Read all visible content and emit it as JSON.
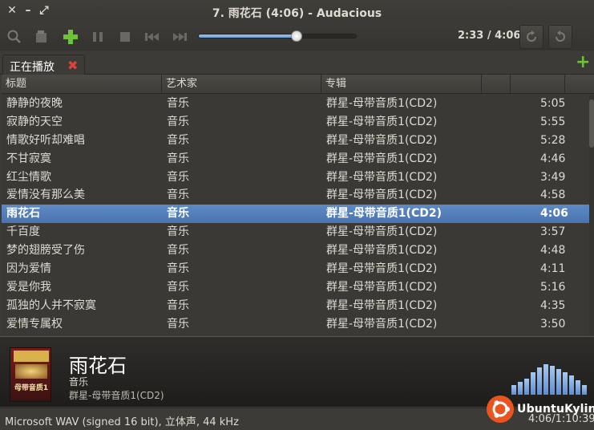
{
  "window": {
    "title": "7. 雨花石 (4:06) - Audacious"
  },
  "toolbar": {
    "time": "2:33 / 4:06",
    "seek_progress": 0.622
  },
  "tabs": [
    {
      "label": "正在播放"
    }
  ],
  "columns": [
    "标题",
    "艺术家",
    "专辑"
  ],
  "rows": [
    {
      "title": "静静的夜晚",
      "artist": "音乐",
      "album": "群星-母带音质1(CD2)",
      "length": "5:05"
    },
    {
      "title": "寂静的天空",
      "artist": "音乐",
      "album": "群星-母带音质1(CD2)",
      "length": "5:55"
    },
    {
      "title": "情歌好听却难唱",
      "artist": "音乐",
      "album": "群星-母带音质1(CD2)",
      "length": "5:28"
    },
    {
      "title": "不甘寂寞",
      "artist": "音乐",
      "album": "群星-母带音质1(CD2)",
      "length": "4:46"
    },
    {
      "title": "红尘情歌",
      "artist": "音乐",
      "album": "群星-母带音质1(CD2)",
      "length": "3:49"
    },
    {
      "title": "爱情没有那么美",
      "artist": "音乐",
      "album": "群星-母带音质1(CD2)",
      "length": "4:58"
    },
    {
      "title": "雨花石",
      "artist": "音乐",
      "album": "群星-母带音质1(CD2)",
      "length": "4:06",
      "current": true
    },
    {
      "title": "千百度",
      "artist": "音乐",
      "album": "群星-母带音质1(CD2)",
      "length": "3:57"
    },
    {
      "title": "梦的翅膀受了伤",
      "artist": "音乐",
      "album": "群星-母带音质1(CD2)",
      "length": "4:48"
    },
    {
      "title": "因为爱情",
      "artist": "音乐",
      "album": "群星-母带音质1(CD2)",
      "length": "4:11"
    },
    {
      "title": "爱是你我",
      "artist": "音乐",
      "album": "群星-母带音质1(CD2)",
      "length": "5:16"
    },
    {
      "title": "孤独的人并不寂寞",
      "artist": "音乐",
      "album": "群星-母带音质1(CD2)",
      "length": "4:35"
    },
    {
      "title": "爱情专属权",
      "artist": "音乐",
      "album": "群星-母带音质1(CD2)",
      "length": "3:50"
    }
  ],
  "now_playing": {
    "title": "雨花石",
    "artist": "音乐",
    "album": "群星-母带音质1(CD2)",
    "art_text": "母带音质1"
  },
  "status": {
    "format": "Microsoft WAV (signed 16 bit), 立体声, 44 kHz",
    "total": "4:06/1:10:39"
  },
  "logo": {
    "text": "UbuntuKylin"
  },
  "colors": {
    "accent": "#5e8ac4",
    "add": "#6dc23a",
    "close": "#e0403a",
    "brand": "#e95420"
  }
}
